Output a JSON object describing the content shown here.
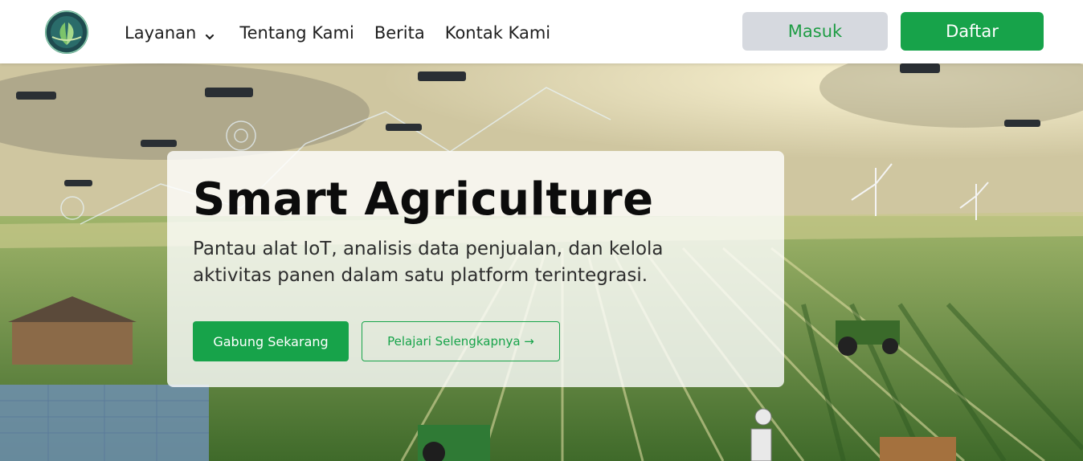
{
  "navbar": {
    "logo_icon": "leaf-globe-logo-icon",
    "items": [
      {
        "label": "Layanan",
        "has_dropdown": true
      },
      {
        "label": "Tentang Kami"
      },
      {
        "label": "Berita"
      },
      {
        "label": "Kontak Kami"
      }
    ],
    "dropdown_icon": "chevron-down-icon",
    "login_label": "Masuk",
    "register_label": "Daftar"
  },
  "hero": {
    "background": "smart-farm-drones-illustration",
    "title": "Smart Agriculture",
    "description": "Pantau alat IoT, analisis data penjualan, dan kelola aktivitas panen dalam satu platform terintegrasi.",
    "primary_cta": "Gabung Sekarang",
    "secondary_cta": "Pelajari Selengkapnya →"
  },
  "colors": {
    "brand_green": "#17a34a",
    "login_bg": "#d6d9df",
    "text_dark": "#1f1f1f"
  }
}
